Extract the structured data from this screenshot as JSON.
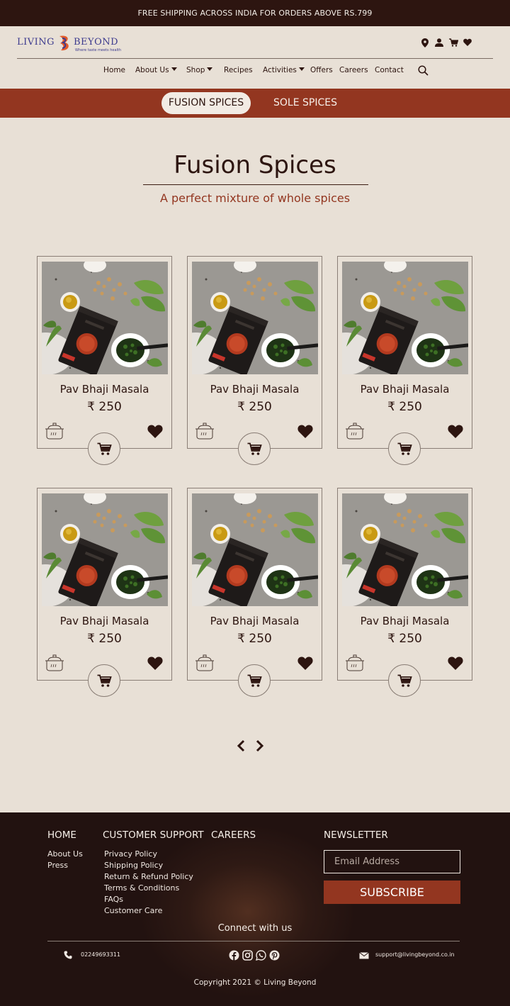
{
  "announcement": "FREE SHIPPING ACROSS INDIA FOR ORDERS ABOVE RS.799",
  "brand": {
    "left": "LIVING",
    "right": "BEYOND",
    "tagline": "Where taste meets health",
    "colors": {
      "primary": "#3c3a8e",
      "accent": "#e25b2b"
    }
  },
  "header_icons": [
    "location-icon",
    "user-icon",
    "cart-icon",
    "heart-icon"
  ],
  "nav": {
    "home": "Home",
    "about": "About Us",
    "shop": "Shop",
    "recipes": "Recipes",
    "activities": "Activities",
    "offers": "Offers",
    "careers": "Careers",
    "contact": "Contact"
  },
  "categories": {
    "active": "FUSION SPICES",
    "other": "SOLE SPICES"
  },
  "section": {
    "title": "Fusion Spices",
    "subtitle": "A perfect mixture of whole spices"
  },
  "products": [
    {
      "name": "Pav Bhaji Masala",
      "price": "₹ 250"
    },
    {
      "name": "Pav Bhaji Masala",
      "price": "₹ 250"
    },
    {
      "name": "Pav Bhaji Masala",
      "price": "₹ 250"
    },
    {
      "name": "Pav Bhaji Masala",
      "price": "₹ 250"
    },
    {
      "name": "Pav Bhaji Masala",
      "price": "₹ 250"
    },
    {
      "name": "Pav Bhaji Masala",
      "price": "₹ 250"
    }
  ],
  "footer": {
    "col1": {
      "heading": "HOME",
      "links": [
        "About Us",
        "Press"
      ]
    },
    "col2": {
      "heading": "CUSTOMER SUPPORT",
      "links": [
        "Privacy Policy",
        "Shipping Policy",
        "Return & Refund Policy",
        "Terms & Conditions",
        "FAQs",
        "Customer Care"
      ]
    },
    "col3": {
      "heading": "CAREERS"
    },
    "newsletter": {
      "heading": "NEWSLETTER",
      "placeholder": "Email Address",
      "button": "SUBSCRIBE"
    },
    "connect": "Connect with us",
    "phone": "02249693311",
    "social_icons": [
      "facebook-icon",
      "instagram-icon",
      "whatsapp-icon",
      "pinterest-icon"
    ],
    "email": "support@livingbeyond.co.in",
    "copyright": "Copyright 2021 © Living Beyond"
  },
  "colors": {
    "background": "#e8e0d6",
    "dark": "#2d1510",
    "accent": "#933620"
  }
}
